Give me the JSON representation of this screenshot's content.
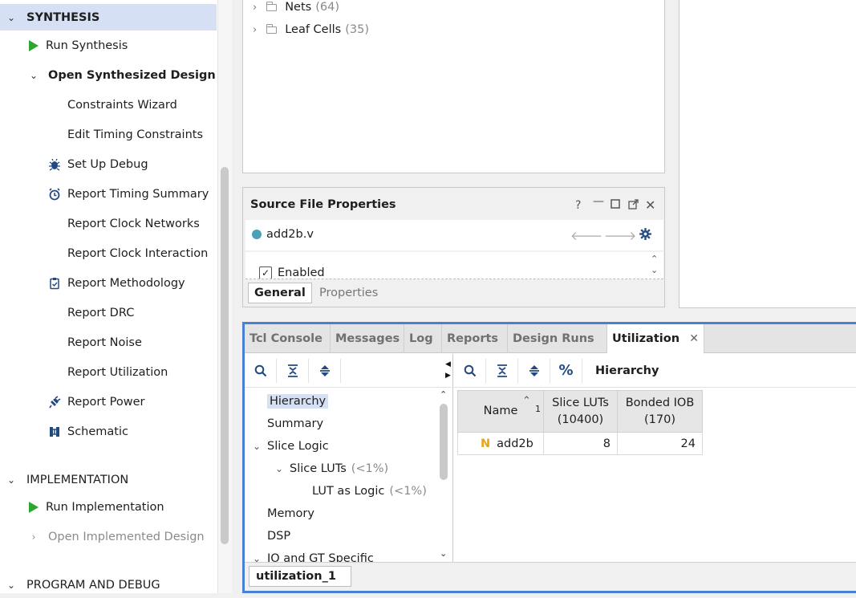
{
  "flow": {
    "synthesis_header": "SYNTHESIS",
    "synthesis_items": [
      {
        "label": "Run Synthesis",
        "icon": "run-icon"
      },
      {
        "label": "Open Synthesized Design",
        "icon": "chevron-down-icon"
      }
    ],
    "synth_sub_items": [
      {
        "label": "Constraints Wizard",
        "icon": ""
      },
      {
        "label": "Edit Timing Constraints",
        "icon": ""
      },
      {
        "label": "Set Up Debug",
        "icon": "bug-icon"
      },
      {
        "label": "Report Timing Summary",
        "icon": "clock-icon"
      },
      {
        "label": "Report Clock Networks",
        "icon": ""
      },
      {
        "label": "Report Clock Interaction",
        "icon": ""
      },
      {
        "label": "Report Methodology",
        "icon": "clipboard-icon"
      },
      {
        "label": "Report DRC",
        "icon": ""
      },
      {
        "label": "Report Noise",
        "icon": ""
      },
      {
        "label": "Report Utilization",
        "icon": ""
      },
      {
        "label": "Report Power",
        "icon": "power-plug-icon"
      },
      {
        "label": "Schematic",
        "icon": "schematic-icon"
      }
    ],
    "implementation_header": "IMPLEMENTATION",
    "run_implementation": "Run Implementation",
    "open_implemented": "Open Implemented Design",
    "program_header": "PROGRAM AND DEBUG"
  },
  "netlist": {
    "nets_label": "Nets",
    "nets_count": "(64)",
    "leaf_label": "Leaf Cells",
    "leaf_count": "(35)"
  },
  "source_props": {
    "title": "Source File Properties",
    "help": "?",
    "filename": "add2b.v",
    "enabled_label": "Enabled",
    "tabs": [
      "General",
      "Properties"
    ]
  },
  "tools": {
    "tabs": [
      "Tcl Console",
      "Messages",
      "Log",
      "Reports",
      "Design Runs",
      "Utilization"
    ],
    "active_tab": "Utilization",
    "right_title": "Hierarchy",
    "percent_symbol": "%",
    "bottom_tab": "utilization_1",
    "tree": [
      {
        "label": "Hierarchy",
        "pct": ""
      },
      {
        "label": "Summary",
        "pct": ""
      },
      {
        "label": "Slice Logic",
        "pct": ""
      },
      {
        "label": "Slice LUTs",
        "pct": "(<1%)"
      },
      {
        "label": "LUT as Logic",
        "pct": "(<1%)"
      },
      {
        "label": "Memory",
        "pct": ""
      },
      {
        "label": "DSP",
        "pct": ""
      },
      {
        "label": "IO and GT Specific",
        "pct": ""
      }
    ],
    "table": {
      "headers": [
        "Name",
        "Slice LUTs",
        "(10400)",
        "Bonded IOB",
        "(170)"
      ],
      "sort_index": "1",
      "rows": [
        {
          "name": "add2b",
          "badge": "N",
          "luts": "8",
          "iob": "24"
        }
      ]
    }
  },
  "colors": {
    "accent_blue": "#4a7fd6",
    "selection": "#d5e0f4",
    "run_green": "#2fa52f",
    "netlist_badge": "#e8a317"
  }
}
